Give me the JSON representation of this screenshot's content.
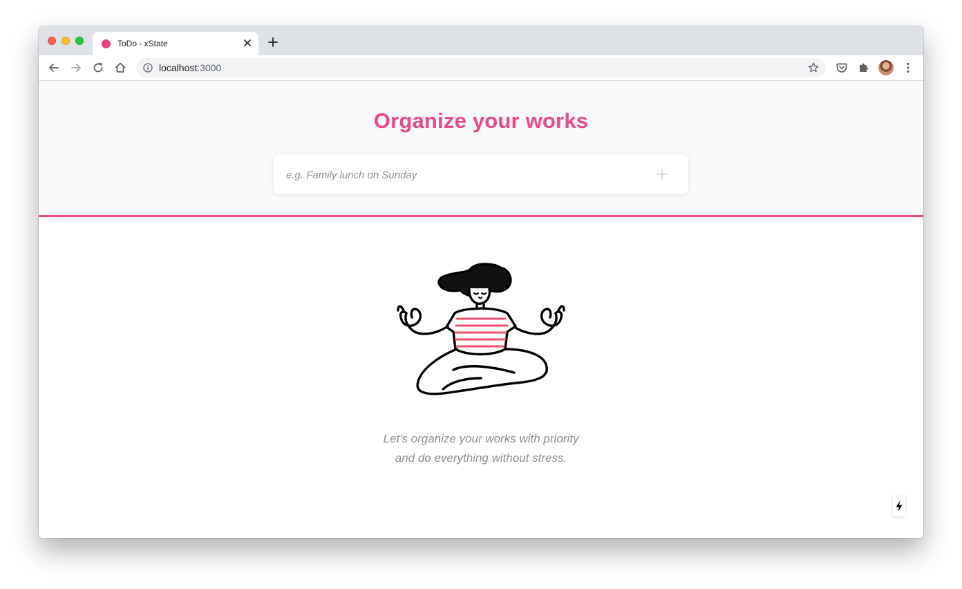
{
  "browser": {
    "tab": {
      "title": "ToDo - xState",
      "favicon_color": "#ec407a"
    },
    "address": {
      "host": "localhost",
      "port": ":3000"
    }
  },
  "page": {
    "heading": "Organize your works",
    "todo_input": {
      "placeholder": "e.g. Family lunch on Sunday",
      "value": ""
    },
    "tagline": {
      "line1": "Let's organize your works with priority",
      "line2": "and do everything without stress."
    }
  },
  "colors": {
    "accent": "#ec4a87",
    "hero_background": "#f9fafb",
    "shirt_stripe": "#f0506e"
  },
  "icons": {
    "tab_close": "close-icon",
    "new_tab": "plus-icon",
    "back": "arrow-left-icon",
    "forward": "arrow-right-icon",
    "reload": "reload-icon",
    "home": "home-icon",
    "site_info": "info-icon",
    "bookmark": "star-icon",
    "pocket": "pocket-icon",
    "extensions": "puzzle-icon",
    "menu": "kebab-menu-icon",
    "add_todo": "plus-icon",
    "dev_indicator": "lightning-bolt-icon"
  }
}
